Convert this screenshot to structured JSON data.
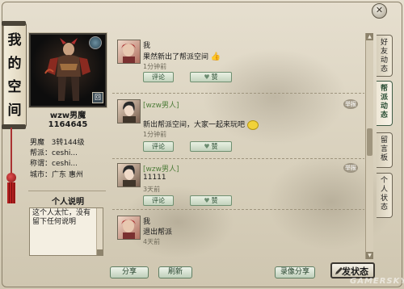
{
  "window": {
    "title_chars": [
      "我",
      "的",
      "空",
      "间"
    ],
    "close_glyph": "✕"
  },
  "profile": {
    "name": "wzw男魔",
    "id": "1164645",
    "level_label": "男魔",
    "level_value": "3转144级",
    "faction_label": "帮派：",
    "faction_value": "ceshi...",
    "title_label": "称谓：",
    "title_value": "ceshi...",
    "city_label": "城市：",
    "city_value": "广东 惠州",
    "intro_heading": "个人说明",
    "intro_text": "这个人太忙，没有留下任何说明",
    "avatar_tab": "回"
  },
  "posts": [
    {
      "name": "我",
      "name_style": "plain",
      "text": "果然新出了帮派空间",
      "emoji": "thumbs-up-icon",
      "time": "1分钟前",
      "buttons": [
        "评论",
        "赞"
      ],
      "ornament": ""
    },
    {
      "name": "[wzw男人]",
      "name_style": "green",
      "text": "新出帮派空间，大家一起来玩吧",
      "emoji": "smiley-icon",
      "time": "1分钟前",
      "buttons": [
        "评论",
        "赞"
      ],
      "ornament": "举报"
    },
    {
      "name": "[wzw男人]",
      "name_style": "green",
      "text": "11111",
      "emoji": "",
      "time": "3天前",
      "buttons": [
        "评论",
        "赞"
      ],
      "ornament": "举报"
    },
    {
      "name": "我",
      "name_style": "plain",
      "text": "退出帮派",
      "emoji": "",
      "time": "4天前",
      "buttons": [
        "评论",
        "赞"
      ],
      "ornament": ""
    }
  ],
  "tabs": [
    {
      "label": [
        "好",
        "友",
        "动",
        "态"
      ],
      "active": false
    },
    {
      "label": [
        "帮",
        "派",
        "动",
        "态"
      ],
      "active": true
    },
    {
      "label": [
        "留",
        "言",
        "板"
      ],
      "active": false
    },
    {
      "label": [
        "个",
        "人",
        "状",
        "态"
      ],
      "active": false
    }
  ],
  "bottom": {
    "share": "分享",
    "refresh": "刷新",
    "record_share": "录像分享",
    "post_status": "发状态"
  },
  "watermark": "GAMERSKY",
  "colors": {
    "accent_green": "#4f7d3a",
    "panel": "#ddd5c2",
    "frame": "#8b8069"
  }
}
